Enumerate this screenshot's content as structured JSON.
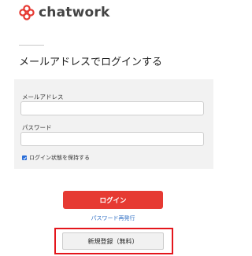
{
  "brand": {
    "name": "chatwork",
    "icon": "chatwork-flower-logo-icon",
    "accent": "#e63a33"
  },
  "page": {
    "title": "メールアドレスでログインする"
  },
  "form": {
    "email_label": "メールアドレス",
    "email_value": "",
    "password_label": "パスワード",
    "password_value": "",
    "remember_label": "ログイン状態を保持する",
    "remember_checked": true
  },
  "actions": {
    "login_label": "ログイン",
    "forgot_label": "パスワード再発行",
    "register_label": "新規登録（無料）"
  },
  "colors": {
    "link": "#2f6fc4",
    "highlight": "#e4161c",
    "form_bg": "#f2f2f2"
  }
}
